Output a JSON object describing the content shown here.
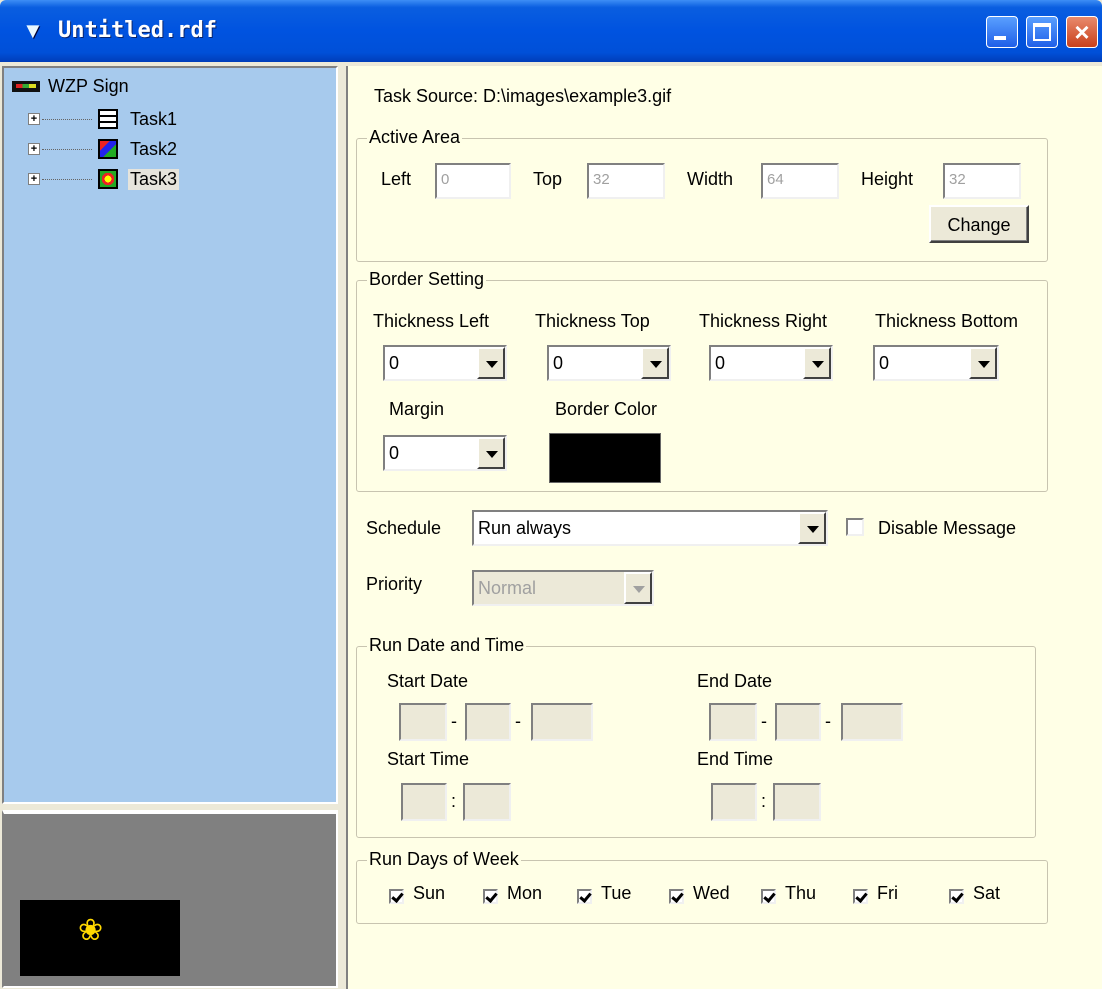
{
  "window": {
    "title": "Untitled.rdf"
  },
  "tree": {
    "root": "WZP Sign",
    "items": [
      {
        "label": "Task1",
        "icon": "document-icon"
      },
      {
        "label": "Task2",
        "icon": "image-icon"
      },
      {
        "label": "Task3",
        "icon": "gif-image-icon",
        "selected": true
      }
    ]
  },
  "task_source": "Task Source: D:\\images\\example3.gif",
  "active_area": {
    "title": "Active Area",
    "left_label": "Left",
    "left_value": "0",
    "top_label": "Top",
    "top_value": "32",
    "width_label": "Width",
    "width_value": "64",
    "height_label": "Height",
    "height_value": "32",
    "change_label": "Change"
  },
  "border": {
    "title": "Border Setting",
    "thickness_left_label": "Thickness Left",
    "thickness_left_value": "0",
    "thickness_top_label": "Thickness Top",
    "thickness_top_value": "0",
    "thickness_right_label": "Thickness Right",
    "thickness_right_value": "0",
    "thickness_bottom_label": "Thickness Bottom",
    "thickness_bottom_value": "0",
    "margin_label": "Margin",
    "margin_value": "0",
    "color_label": "Border Color",
    "color": "#000000"
  },
  "schedule": {
    "label": "Schedule",
    "value": "Run always",
    "disable_label": "Disable Message",
    "disable_checked": false
  },
  "priority": {
    "label": "Priority",
    "value": "Normal"
  },
  "run_date": {
    "title": "Run Date and Time",
    "start_date_label": "Start Date",
    "end_date_label": "End Date",
    "start_time_label": "Start Time",
    "end_time_label": "End Time",
    "date_sep": "-",
    "time_sep": ":"
  },
  "run_days": {
    "title": "Run Days of Week",
    "days": [
      {
        "label": "Sun",
        "checked": true
      },
      {
        "label": "Mon",
        "checked": true
      },
      {
        "label": "Tue",
        "checked": true
      },
      {
        "label": "Wed",
        "checked": true
      },
      {
        "label": "Thu",
        "checked": true
      },
      {
        "label": "Fri",
        "checked": true
      },
      {
        "label": "Sat",
        "checked": true
      }
    ]
  }
}
